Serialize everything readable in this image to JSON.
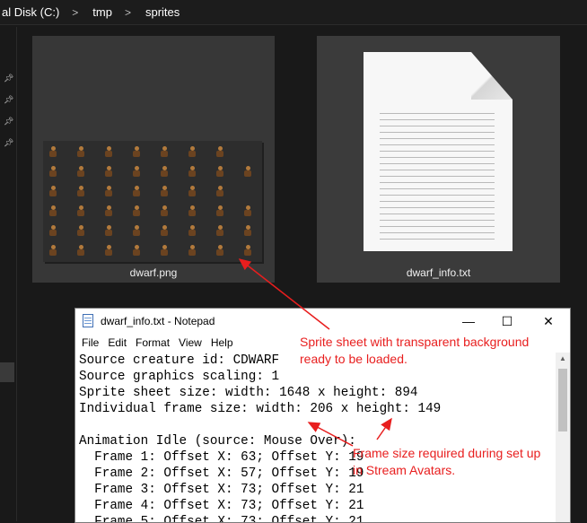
{
  "explorer": {
    "breadcrumbs": [
      "al Disk (C:)",
      "tmp",
      "sprites"
    ],
    "separator": ">",
    "files": [
      {
        "name": "dwarf.png",
        "type": "image"
      },
      {
        "name": "dwarf_info.txt",
        "type": "text"
      }
    ],
    "pin_icon": "pin-icon"
  },
  "notepad": {
    "title": "dwarf_info.txt - Notepad",
    "controls": {
      "minimize": "—",
      "maximize": "☐",
      "close": "✕"
    },
    "menu": [
      "File",
      "Edit",
      "Format",
      "View",
      "Help"
    ],
    "lines": [
      "Source creature id: CDWARF",
      "Source graphics scaling: 1",
      "Sprite sheet size: width: 1648 x height: 894",
      "Individual frame size: width: 206 x height: 149",
      "",
      "Animation Idle (source: Mouse Over):",
      "  Frame 1: Offset X: 63; Offset Y: 19",
      "  Frame 2: Offset X: 57; Offset Y: 19",
      "  Frame 3: Offset X: 73; Offset Y: 21",
      "  Frame 4: Offset X: 73; Offset Y: 21",
      "  Frame 5: Offset X: 73; Offset Y: 21"
    ]
  },
  "annotations": {
    "sprite_note": [
      "Sprite sheet with transparent background",
      "ready to be loaded."
    ],
    "frame_note": [
      "Frame size required during set up",
      "in Stream Avatars."
    ],
    "color": "#e81e1e"
  }
}
